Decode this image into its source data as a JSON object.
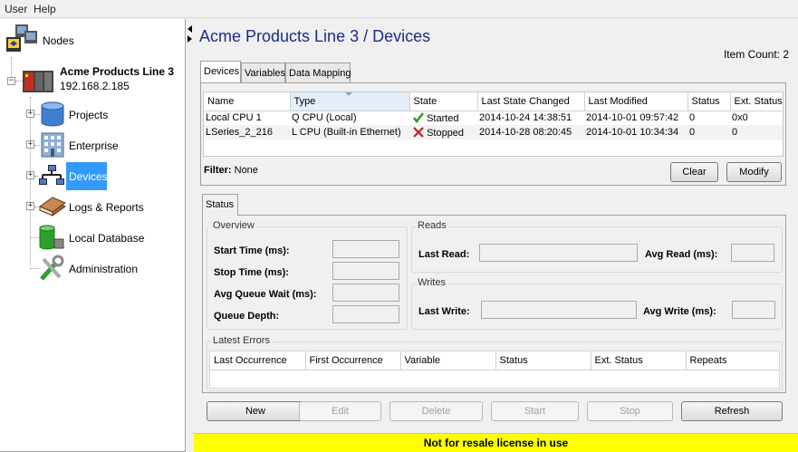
{
  "menu": {
    "items": [
      "User",
      "Help"
    ]
  },
  "tree": {
    "root": "Nodes",
    "node": {
      "name": "Acme Products Line 3",
      "ip": "192.168.2.185"
    },
    "items": [
      {
        "label": "Projects",
        "icon": "database-icon"
      },
      {
        "label": "Enterprise",
        "icon": "building-icon"
      },
      {
        "label": "Devices",
        "icon": "network-icon",
        "selected": true
      },
      {
        "label": "Logs & Reports",
        "icon": "books-icon"
      },
      {
        "label": "Local Database",
        "icon": "local-database-icon"
      },
      {
        "label": "Administration",
        "icon": "tools-icon"
      }
    ]
  },
  "main": {
    "title": "Acme Products Line 3 / Devices",
    "item_count": "Item Count: 2",
    "tabs": [
      "Devices",
      "Variables",
      "Data Mapping"
    ],
    "table": {
      "columns": [
        "Name",
        "Type",
        "State",
        "Last State Changed",
        "Last Modified",
        "Status",
        "Ext. Status"
      ],
      "rows": [
        {
          "name": "Local CPU 1",
          "type": "Q CPU (Local)",
          "state": "Started",
          "state_icon": "check-icon",
          "last_state_changed": "2014-10-24 14:38:51",
          "last_modified": "2014-10-01 09:57:42",
          "status": "0",
          "ext_status": "0x0"
        },
        {
          "name": "LSeries_2_216",
          "type": "L CPU (Built-in Ethernet)",
          "state": "Stopped",
          "state_icon": "x-icon",
          "last_state_changed": "2014-10-28 08:20:45",
          "last_modified": "2014-10-01 10:34:34",
          "status": "0",
          "ext_status": "0"
        }
      ]
    },
    "filter": {
      "label": "Filter:",
      "value": "None"
    },
    "clear_label": "Clear",
    "modify_label": "Modify",
    "status_tab": "Status",
    "overview": {
      "title": "Overview",
      "fields": [
        "Start Time (ms):",
        "Stop Time (ms):",
        "Avg Queue Wait (ms):",
        "Queue Depth:"
      ]
    },
    "reads": {
      "title": "Reads",
      "last_read": "Last Read:",
      "avg_read": "Avg Read (ms):"
    },
    "writes": {
      "title": "Writes",
      "last_write": "Last Write:",
      "avg_write": "Avg Write (ms):"
    },
    "errors": {
      "title": "Latest Errors",
      "columns": [
        "Last Occurrence",
        "First Occurrence",
        "Variable",
        "Status",
        "Ext. Status",
        "Repeats"
      ]
    },
    "buttons": {
      "new": "New",
      "edit": "Edit",
      "delete": "Delete",
      "start": "Start",
      "stop": "Stop",
      "refresh": "Refresh"
    },
    "license": "Not for resale license in use"
  },
  "colors": {
    "title": "#1c2a8c",
    "selection": "#3399ff",
    "license_bg": "#ffff00",
    "started": "#2a9a2a",
    "stopped": "#c02020"
  }
}
